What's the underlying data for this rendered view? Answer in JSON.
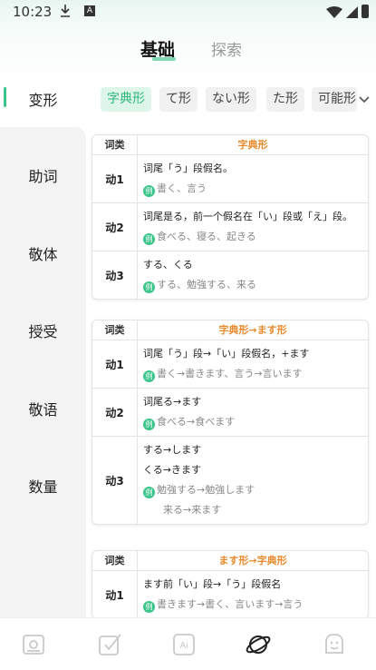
{
  "status": {
    "time": "10:23",
    "a_glyph": "A"
  },
  "header": {
    "tab_basic": "基础",
    "tab_explore": "探索"
  },
  "sidebar": {
    "active": "变形",
    "items": [
      "助词",
      "敬体",
      "授受",
      "敬语",
      "数量"
    ]
  },
  "tags": [
    "字典形",
    "て形",
    "ない形",
    "た形",
    "可能形"
  ],
  "cards": [
    {
      "head_key": "词类",
      "head_val": "字典形",
      "rows": [
        {
          "k": "动1",
          "lines": [
            "词尾「う」段假名。"
          ],
          "example": "書く、言う"
        },
        {
          "k": "动2",
          "lines": [
            "词尾是る，前一个假名在「い」段或「え」段。"
          ],
          "example": "食べる、寝る、起きる"
        },
        {
          "k": "动3",
          "lines": [
            "する、くる"
          ],
          "example": "する、勉強する、来る"
        }
      ]
    },
    {
      "head_key": "词类",
      "head_val": "字典形→ます形",
      "rows": [
        {
          "k": "动1",
          "lines": [
            "词尾「う」段→「い」段假名，+ます"
          ],
          "example": "書く→書きます、言う→言います"
        },
        {
          "k": "动2",
          "lines": [
            "词尾る→ます"
          ],
          "example": "食べる→食べます"
        },
        {
          "k": "动3",
          "lines": [
            "する→します",
            "くる→きます"
          ],
          "example": "勉強する→勉強します",
          "extra": "来る→来ます"
        }
      ]
    },
    {
      "head_key": "词类",
      "head_val": "ます形→字典形",
      "rows": [
        {
          "k": "动1",
          "lines": [
            "ます前「い」段→「う」段假名"
          ],
          "example": "書きます→書く、言います→言う"
        }
      ]
    }
  ],
  "example_badge": "例",
  "bottom_nav": [
    "book-icon",
    "check-icon",
    "ai-icon",
    "planet-icon",
    "face-icon"
  ],
  "nav_ai_label": "Ai",
  "colors": {
    "accent": "#3cc58a",
    "head_orange": "#e98a2c",
    "tag_active_bg": "#def6ea"
  }
}
